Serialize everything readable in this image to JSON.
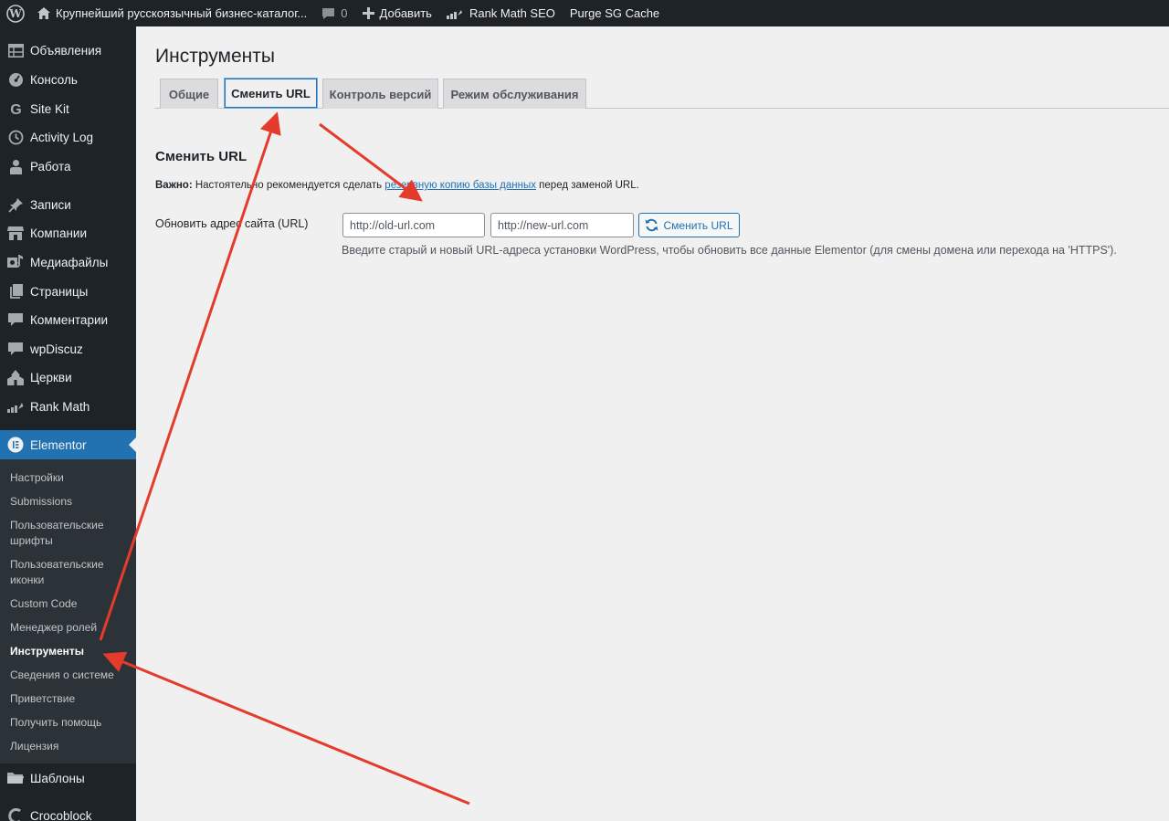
{
  "adminbar": {
    "site_title": "Крупнейший русскоязычный бизнес-каталог...",
    "comments_count": "0",
    "add_label": "Добавить",
    "rank_math_label": "Rank Math SEO",
    "purge_label": "Purge SG Cache"
  },
  "sidebar": {
    "items": [
      {
        "label": "Объявления",
        "icon": "table-icon"
      },
      {
        "label": "Консоль",
        "icon": "gauge-icon"
      },
      {
        "label": "Site Kit",
        "icon": "google-g-icon"
      },
      {
        "label": "Activity Log",
        "icon": "clock-icon"
      },
      {
        "label": "Работа",
        "icon": "person-icon"
      },
      {
        "label": "Записи",
        "icon": "pin-icon"
      },
      {
        "label": "Компании",
        "icon": "store-icon"
      },
      {
        "label": "Медиафайлы",
        "icon": "media-icon"
      },
      {
        "label": "Страницы",
        "icon": "pages-icon"
      },
      {
        "label": "Комментарии",
        "icon": "comment-icon"
      },
      {
        "label": "wpDiscuz",
        "icon": "comment-icon"
      },
      {
        "label": "Церкви",
        "icon": "church-icon"
      },
      {
        "label": "Rank Math",
        "icon": "chart-icon"
      },
      {
        "label": "Elementor",
        "icon": "elementor-icon"
      },
      {
        "label": "Шаблоны",
        "icon": "folder-icon"
      },
      {
        "label": "Crocoblock",
        "icon": "crocoblock-icon"
      }
    ],
    "submenu": [
      "Настройки",
      "Submissions",
      "Пользовательские шрифты",
      "Пользовательские иконки",
      "Custom Code",
      "Менеджер ролей",
      "Инструменты",
      "Сведения о системе",
      "Приветствие",
      "Получить помощь",
      "Лицензия"
    ]
  },
  "main": {
    "title": "Инструменты",
    "tabs": [
      "Общие",
      "Сменить URL",
      "Контроль версий",
      "Режим обслуживания"
    ],
    "active_tab": "Сменить URL",
    "section_title": "Сменить URL",
    "notice": {
      "bold": "Важно:",
      "before_link": " Настоятельно рекомендуется сделать ",
      "link": "резервную копию базы данных",
      "after_link": " перед заменой URL."
    },
    "form": {
      "label": "Обновить адрес сайта (URL)",
      "old_url_placeholder": "http://old-url.com",
      "new_url_placeholder": "http://new-url.com",
      "button_label": "Сменить URL",
      "description": "Введите старый и новый URL-адреса установки WordPress, чтобы обновить все данные Elementor (для смены домена или перехода на 'HTTPS')."
    }
  },
  "colors": {
    "admin_bg": "#1d2327",
    "accent": "#2271b1",
    "submenu_bg": "#2c3338",
    "annotation_arrow": "#e53b2c"
  }
}
